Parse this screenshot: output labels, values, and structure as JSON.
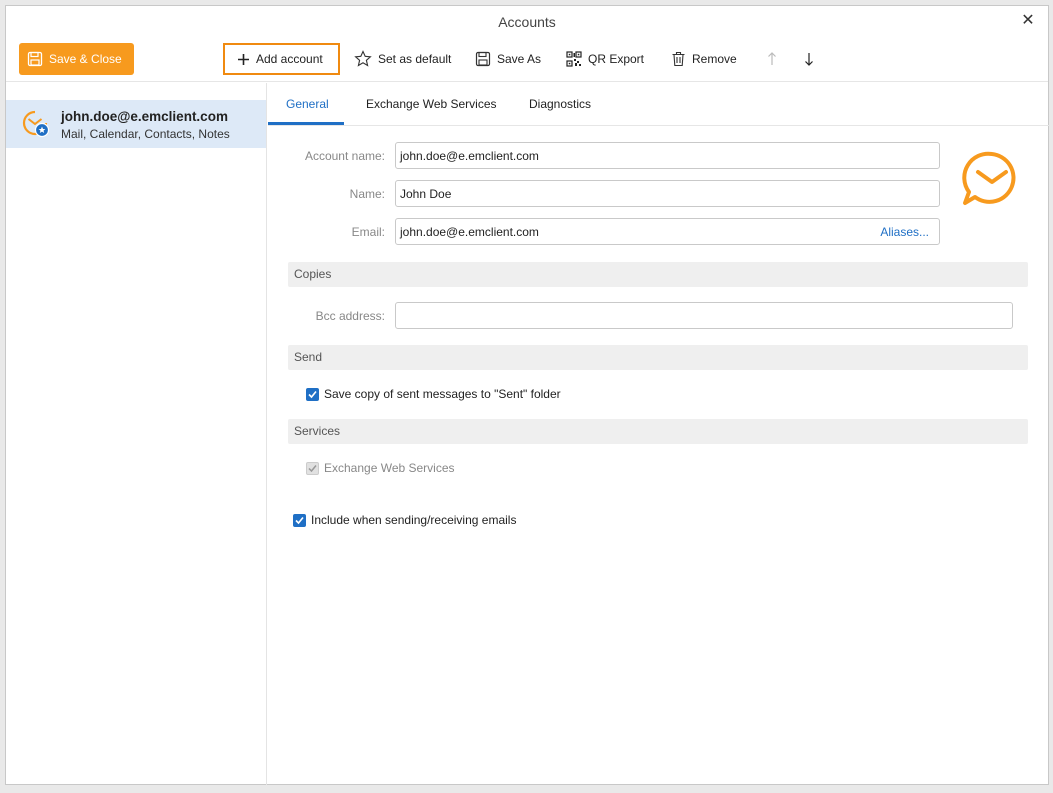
{
  "window": {
    "title": "Accounts"
  },
  "toolbar": {
    "save_close": "Save & Close",
    "add_account": "Add account",
    "set_default": "Set as default",
    "save_as": "Save As",
    "qr_export": "QR Export",
    "remove": "Remove"
  },
  "sidebar": {
    "accounts": [
      {
        "email": "john.doe@e.emclient.com",
        "services": "Mail, Calendar, Contacts, Notes"
      }
    ]
  },
  "tabs": [
    "General",
    "Exchange Web Services",
    "Diagnostics"
  ],
  "general": {
    "account_name_label": "Account name:",
    "account_name_value": "john.doe@e.emclient.com",
    "name_label": "Name:",
    "name_value": "John Doe",
    "email_label": "Email:",
    "email_value": "john.doe@e.emclient.com",
    "aliases_link": "Aliases...",
    "copies_header": "Copies",
    "bcc_label": "Bcc address:",
    "bcc_value": "",
    "send_header": "Send",
    "save_copy_label": "Save copy of sent messages to \"Sent\" folder",
    "services_header": "Services",
    "ews_service_label": "Exchange Web Services",
    "include_label": "Include when sending/receiving emails"
  },
  "colors": {
    "accent": "#1f6fc5",
    "brand": "#f79a1e"
  }
}
